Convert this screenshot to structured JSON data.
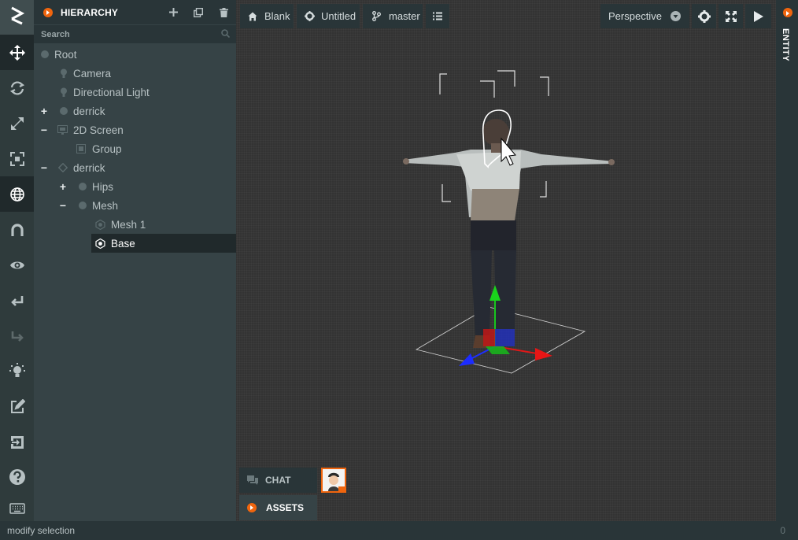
{
  "toolbar": {
    "items": [
      {
        "icon": "move-icon"
      },
      {
        "icon": "rotate-icon"
      },
      {
        "icon": "scale-icon"
      },
      {
        "icon": "resize-icon"
      },
      {
        "icon": "world-space-icon"
      },
      {
        "icon": "snap-icon"
      },
      {
        "icon": "preview-icon"
      },
      {
        "icon": "undo-icon"
      },
      {
        "icon": "redo-icon"
      },
      {
        "icon": "lightmapper-icon"
      },
      {
        "icon": "code-editor-icon"
      },
      {
        "icon": "publish-icon"
      }
    ]
  },
  "hierarchy": {
    "title": "HIERARCHY",
    "search_placeholder": "Search",
    "tree": [
      {
        "label": "Root",
        "icon": "entity-icon",
        "expand": ""
      },
      {
        "label": "Camera",
        "icon": "camera-icon",
        "expand": ""
      },
      {
        "label": "Directional Light",
        "icon": "light-icon",
        "expand": ""
      },
      {
        "label": "derrick",
        "icon": "entity-icon",
        "expand": "+"
      },
      {
        "label": "2D Screen",
        "icon": "screen-icon",
        "expand": "−"
      },
      {
        "label": "Group",
        "icon": "group-icon",
        "expand": ""
      },
      {
        "label": "derrick",
        "icon": "model-icon",
        "expand": "−"
      },
      {
        "label": "Hips",
        "icon": "entity-icon",
        "expand": "+"
      },
      {
        "label": "Mesh",
        "icon": "entity-icon",
        "expand": "−"
      },
      {
        "label": "Mesh 1",
        "icon": "render-icon",
        "expand": ""
      },
      {
        "label": "Base",
        "icon": "render-icon",
        "expand": "",
        "selected": true
      }
    ]
  },
  "topbar": {
    "project": "Blank",
    "scene": "Untitled",
    "branch": "master",
    "camera": "Perspective"
  },
  "right_panel": {
    "title": "ENTITY"
  },
  "bottom_tabs": {
    "chat": "CHAT",
    "assets": "ASSETS"
  },
  "status": {
    "message": "modify selection",
    "count": "0"
  },
  "colors": {
    "accent": "#f0650e",
    "panel": "#364346",
    "dark": "#293538",
    "selected": "#20292b"
  }
}
